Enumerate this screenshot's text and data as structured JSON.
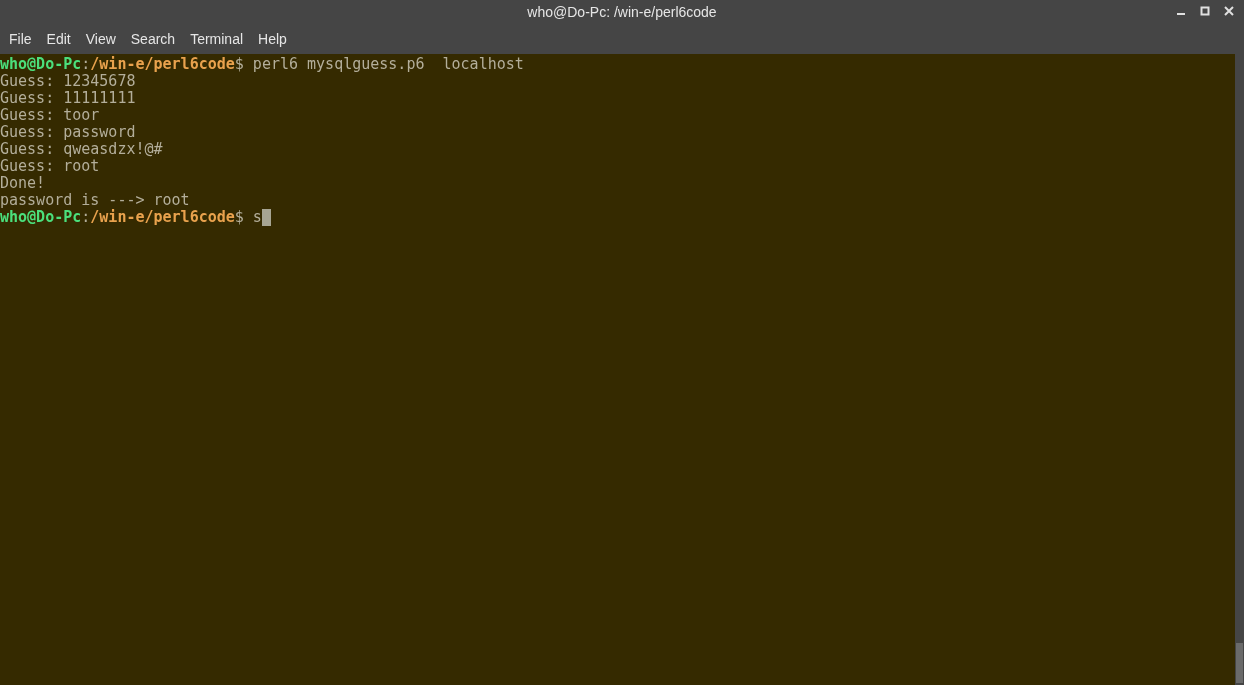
{
  "window": {
    "title": "who@Do-Pc: /win-e/perl6code"
  },
  "menu": [
    "File",
    "Edit",
    "View",
    "Search",
    "Terminal",
    "Help"
  ],
  "lines": [
    {
      "kind": "prompt",
      "user": "who@Do-Pc",
      "separator": ":",
      "path": "/win-e/perl6code",
      "symbol": "$",
      "command": "perl6 mysqlguess.p6  localhost",
      "cursor": false
    },
    {
      "kind": "output",
      "text": "Guess: 12345678"
    },
    {
      "kind": "output",
      "text": "Guess: 11111111"
    },
    {
      "kind": "output",
      "text": "Guess: toor"
    },
    {
      "kind": "output",
      "text": "Guess: password"
    },
    {
      "kind": "output",
      "text": "Guess: qweasdzx!@#"
    },
    {
      "kind": "output",
      "text": "Guess: root"
    },
    {
      "kind": "output",
      "text": "Done!"
    },
    {
      "kind": "output",
      "text": "password is ---> root"
    },
    {
      "kind": "prompt",
      "user": "who@Do-Pc",
      "separator": ":",
      "path": "/win-e/perl6code",
      "symbol": "$",
      "command": "s",
      "cursor": true
    }
  ]
}
